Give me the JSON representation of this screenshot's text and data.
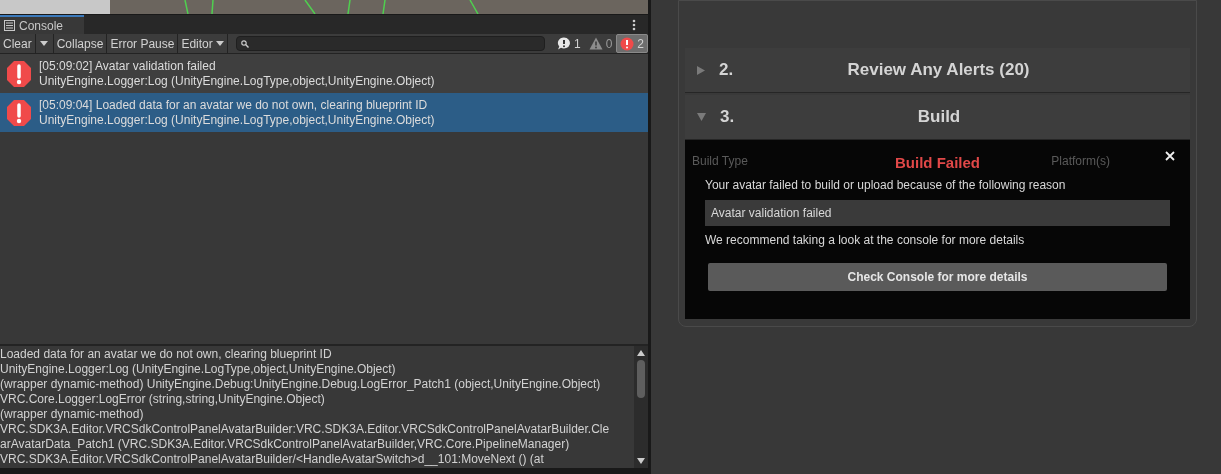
{
  "console": {
    "tab": "Console",
    "toolbar": [
      {
        "label": "Clear",
        "kind": "button"
      },
      {
        "label": "Collapse",
        "kind": "button"
      },
      {
        "label": "Error Pause",
        "kind": "button"
      },
      {
        "label": "Editor",
        "kind": "dropdown"
      }
    ],
    "counters": [
      {
        "kind": "info",
        "count": "1",
        "selected": false
      },
      {
        "kind": "warning",
        "count": "0",
        "selected": false
      },
      {
        "kind": "error",
        "count": "2",
        "selected": true
      }
    ],
    "entries": [
      {
        "line_1": "[05:09:02] Avatar validation failed",
        "line_2": "UnityEngine.Logger:Log (UnityEngine.LogType,object,UnityEngine.Object)",
        "selected": false
      },
      {
        "line_1": "[05:09:04] Loaded data for an avatar we do not own, clearing blueprint ID",
        "line_2": "UnityEngine.Logger:Log (UnityEngine.LogType,object,UnityEngine.Object)",
        "selected": true
      }
    ],
    "details": [
      "Loaded data for an avatar we do not own, clearing blueprint ID",
      "UnityEngine.Logger:Log (UnityEngine.LogType,object,UnityEngine.Object)",
      "(wrapper dynamic-method) UnityEngine.Debug:UnityEngine.Debug.LogError_Patch1 (object,UnityEngine.Object)",
      "VRC.Core.Logger:LogError (string,string,UnityEngine.Object)",
      "(wrapper dynamic-method)",
      "VRC.SDK3A.Editor.VRCSdkControlPanelAvatarBuilder:VRC.SDK3A.Editor.VRCSdkControlPanelAvatarBuilder.Cle",
      "arAvatarData_Patch1 (VRC.SDK3A.Editor.VRCSdkControlPanelAvatarBuilder,VRC.Core.PipelineManager)",
      "VRC.SDK3A.Editor.VRCSdkControlPanelAvatarBuilder/<HandleAvatarSwitch>d__101:MoveNext () (at"
    ]
  },
  "builder": {
    "sections": [
      {
        "number": "2.",
        "title": "Review Any Alerts (20)",
        "expanded": false
      },
      {
        "number": "3.",
        "title": "Build",
        "expanded": true
      }
    ],
    "background_labels": [
      "Build Type",
      "Platform(s)"
    ],
    "dialog": {
      "title": "Build Failed",
      "message": "Your avatar failed to build or upload because of the following reason",
      "reason": "Avatar validation failed",
      "hint": "We recommend taking a look at the console for more details",
      "button": "Check Console for more details"
    }
  }
}
